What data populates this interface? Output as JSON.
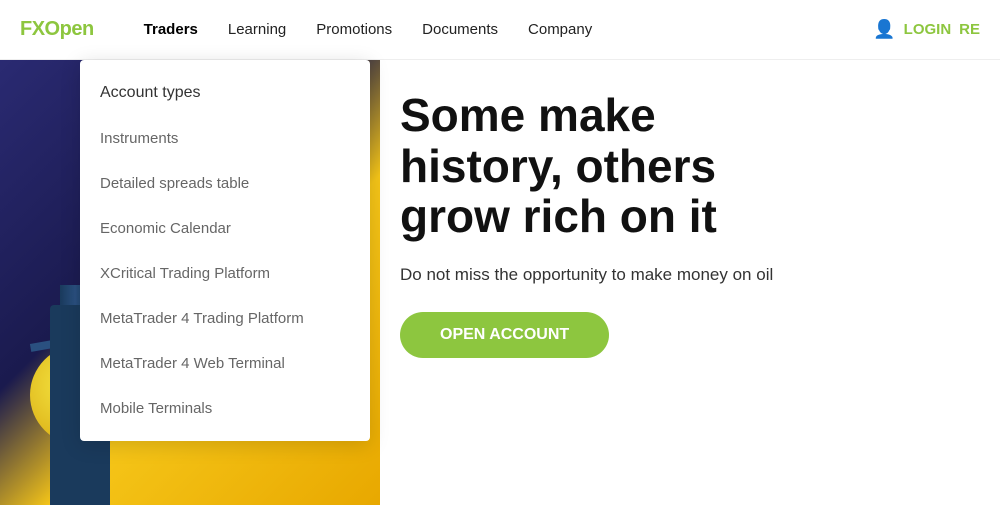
{
  "header": {
    "logo": "FXOpen",
    "nav": {
      "items": [
        {
          "label": "Traders",
          "id": "traders"
        },
        {
          "label": "Learning",
          "id": "learning"
        },
        {
          "label": "Promotions",
          "id": "promotions"
        },
        {
          "label": "Documents",
          "id": "documents"
        },
        {
          "label": "Company",
          "id": "company"
        }
      ]
    },
    "login_label": "LOGIN",
    "register_label": "RE"
  },
  "dropdown": {
    "items": [
      {
        "label": "Account types",
        "id": "account-types"
      },
      {
        "label": "Instruments",
        "id": "instruments"
      },
      {
        "label": "Detailed spreads table",
        "id": "detailed-spreads"
      },
      {
        "label": "Economic Calendar",
        "id": "economic-calendar"
      },
      {
        "label": "XCritical Trading Platform",
        "id": "xcritical"
      },
      {
        "label": "MetaTrader 4 Trading Platform",
        "id": "mt4"
      },
      {
        "label": "MetaTrader 4 Web Terminal",
        "id": "mt4-web"
      },
      {
        "label": "Mobile Terminals",
        "id": "mobile"
      }
    ]
  },
  "hero": {
    "heading": "Some make history, others grow rich on it",
    "subtext": "Do not miss the opportunity to make money on oil",
    "cta_label": "OPEN ACCOUNT"
  }
}
